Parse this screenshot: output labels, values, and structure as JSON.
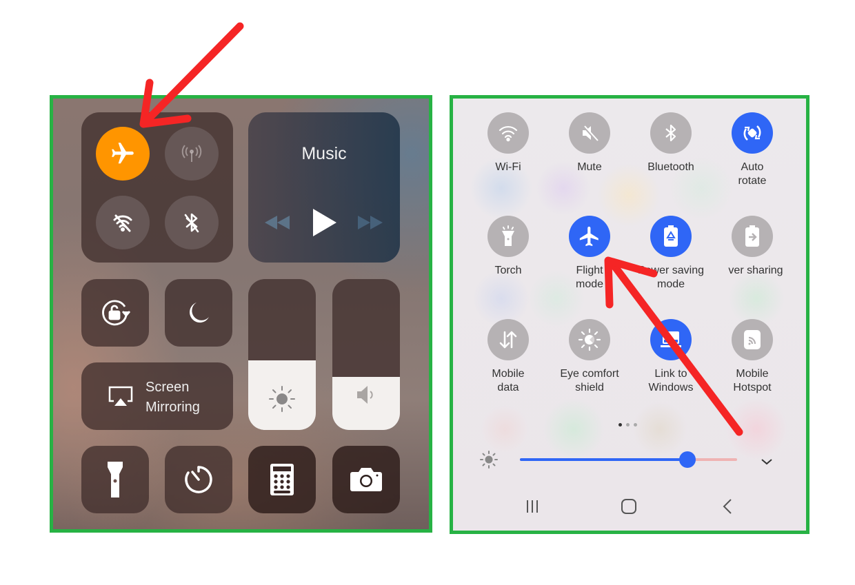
{
  "annotation": {
    "arrow_color": "#f52525",
    "frame_color": "#27b244"
  },
  "ios": {
    "connectivity": [
      {
        "id": "airplane",
        "label": "Airplane Mode",
        "state": "on",
        "color": "#ff9500"
      },
      {
        "id": "cellular",
        "label": "Cellular Data",
        "state": "off"
      },
      {
        "id": "wifi",
        "label": "Wi-Fi",
        "state": "off"
      },
      {
        "id": "bluetooth",
        "label": "Bluetooth",
        "state": "off"
      }
    ],
    "music": {
      "title": "Music",
      "controls": [
        "rewind",
        "play",
        "fast-forward"
      ]
    },
    "toggles": [
      {
        "id": "rotation-lock",
        "label": "Rotation Lock"
      },
      {
        "id": "do-not-disturb",
        "label": "Do Not Disturb"
      }
    ],
    "screen_mirroring": {
      "line1": "Screen",
      "line2": "Mirroring"
    },
    "brightness_level": 0.46,
    "volume_level": 0.35,
    "shortcuts": [
      "flashlight",
      "timer",
      "calculator",
      "camera"
    ]
  },
  "samsung": {
    "tiles": [
      {
        "label": "Wi-Fi",
        "icon": "wifi-icon",
        "on": false
      },
      {
        "label": "Mute",
        "icon": "mute-icon",
        "on": false
      },
      {
        "label": "Bluetooth",
        "icon": "bluetooth-icon",
        "on": false
      },
      {
        "label": "Auto\nrotate",
        "icon": "auto-rotate-icon",
        "on": true
      },
      {
        "label": "Torch",
        "icon": "torch-icon",
        "on": false
      },
      {
        "label": "Flight\nmode",
        "icon": "airplane-icon",
        "on": true
      },
      {
        "label": "Power saving\nmode",
        "icon": "battery-saver-icon",
        "on": true
      },
      {
        "label": "ver sharing",
        "icon": "power-share-icon",
        "on": false
      },
      {
        "label": "Mobile\ndata",
        "icon": "mobile-data-icon",
        "on": false
      },
      {
        "label": "Eye comfort\nshield",
        "icon": "eye-comfort-icon",
        "on": false
      },
      {
        "label": "Link to\nWindows",
        "icon": "link-windows-icon",
        "on": true
      },
      {
        "label": "Mobile\nHotspot",
        "icon": "hotspot-icon",
        "on": false
      }
    ],
    "page_indicator": {
      "current": 1,
      "total": 3
    },
    "brightness_level": 0.77,
    "accent": "#2f66f6",
    "nav": [
      "recent-apps",
      "home",
      "back"
    ]
  }
}
